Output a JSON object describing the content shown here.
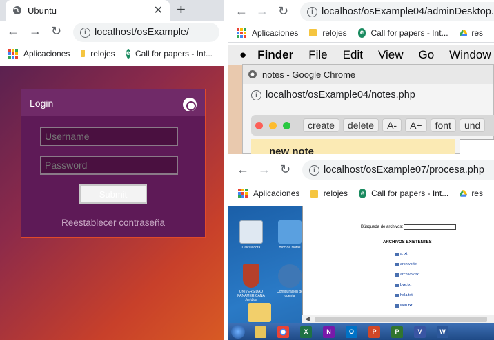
{
  "left_window": {
    "tab": {
      "title": "Ubuntu",
      "close": "✕",
      "new_tab": "+"
    },
    "nav": {
      "url": "localhost/osExample/"
    },
    "bookmarks": [
      {
        "label": "Aplicaciones",
        "icon": "apps-icon"
      },
      {
        "label": "relojes",
        "icon": "folder-icon"
      },
      {
        "label": "Call for papers - Int...",
        "icon": "cfp-icon"
      }
    ],
    "login": {
      "title": "Login",
      "username_placeholder": "Username",
      "password_placeholder": "Password",
      "submit_label": "Submit",
      "reset_link": "Reestablecer contraseña"
    }
  },
  "right_top_window": {
    "nav": {
      "url": "localhost/osExample04/adminDesktop.p"
    },
    "bookmarks": [
      {
        "label": "Aplicaciones",
        "icon": "apps-icon"
      },
      {
        "label": "relojes",
        "icon": "folder-icon"
      },
      {
        "label": "Call for papers - Int...",
        "icon": "cfp-icon"
      },
      {
        "label": "res",
        "icon": "drive-icon"
      }
    ],
    "mac_menu": [
      "Finder",
      "File",
      "Edit",
      "View",
      "Go",
      "Window"
    ],
    "notes_window": {
      "title": "notes - Google Chrome",
      "url": "localhost/osExample04/notes.php",
      "toolbar": [
        "create",
        "delete",
        "A-",
        "A+",
        "font",
        "und"
      ],
      "note_title": "new note"
    }
  },
  "right_bottom_window": {
    "nav": {
      "url": "localhost/osExample07/procesa.php"
    },
    "bookmarks": [
      {
        "label": "Aplicaciones",
        "icon": "apps-icon"
      },
      {
        "label": "relojes",
        "icon": "folder-icon"
      },
      {
        "label": "Call for papers - Int...",
        "icon": "cfp-icon"
      },
      {
        "label": "res",
        "icon": "drive-icon"
      }
    ],
    "desktop_icons": [
      {
        "label": "Calculadora"
      },
      {
        "label": "Bloc de Notas"
      },
      {
        "label": "UNIVERSIDAD PANAMERICANA Jurídica"
      },
      {
        "label": "Configuración de cuenta"
      }
    ],
    "page": {
      "search_label": "Búsqueda de archivos:",
      "files_title": "ARCHIVOS EXISTENTES",
      "files": [
        "a.txt",
        "archivo.txt",
        "archivo2.txt",
        "bye.txt",
        "hola.txt",
        "web.txt"
      ]
    },
    "taskbar_icons": [
      "X",
      "N",
      "O",
      "P",
      "P",
      "V",
      "W"
    ]
  }
}
